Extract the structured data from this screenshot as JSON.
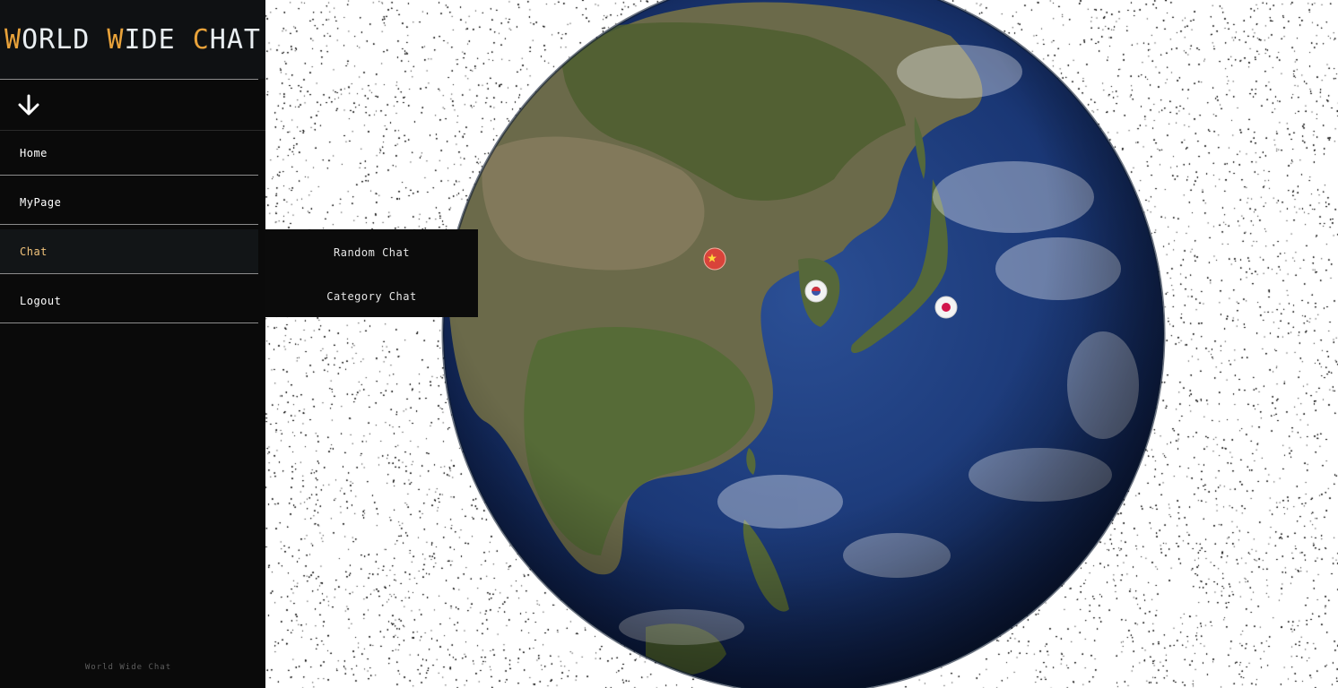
{
  "app": {
    "logo_parts": [
      {
        "text": "W",
        "accent": true
      },
      {
        "text": "ORLD ",
        "accent": false
      },
      {
        "text": "W",
        "accent": true
      },
      {
        "text": "IDE ",
        "accent": false
      },
      {
        "text": "C",
        "accent": true
      },
      {
        "text": "HAT",
        "accent": false
      }
    ]
  },
  "sidebar": {
    "toggle_icon": "arrow-down-icon",
    "items": [
      {
        "label": "Home"
      },
      {
        "label": "MyPage"
      },
      {
        "label": "Chat"
      },
      {
        "label": "Logout"
      }
    ],
    "footer": "World Wide Chat"
  },
  "submenu": {
    "items": [
      {
        "label": "Random Chat"
      },
      {
        "label": "Category Chat"
      }
    ]
  },
  "globe": {
    "markers": [
      {
        "name": "china-flag-marker",
        "icon": "china-flag-icon",
        "color": "#d9433a"
      },
      {
        "name": "korea-flag-marker",
        "icon": "south-korea-flag-icon",
        "color": "#f2f2f2"
      },
      {
        "name": "japan-flag-marker",
        "icon": "japan-flag-icon",
        "color": "#f4f4f4"
      }
    ]
  },
  "colors": {
    "sidebar_bg": "#0a0a0a",
    "accent": "#e8a23a",
    "ocean": "#1c3a7a",
    "land": "#5d6b3f"
  }
}
